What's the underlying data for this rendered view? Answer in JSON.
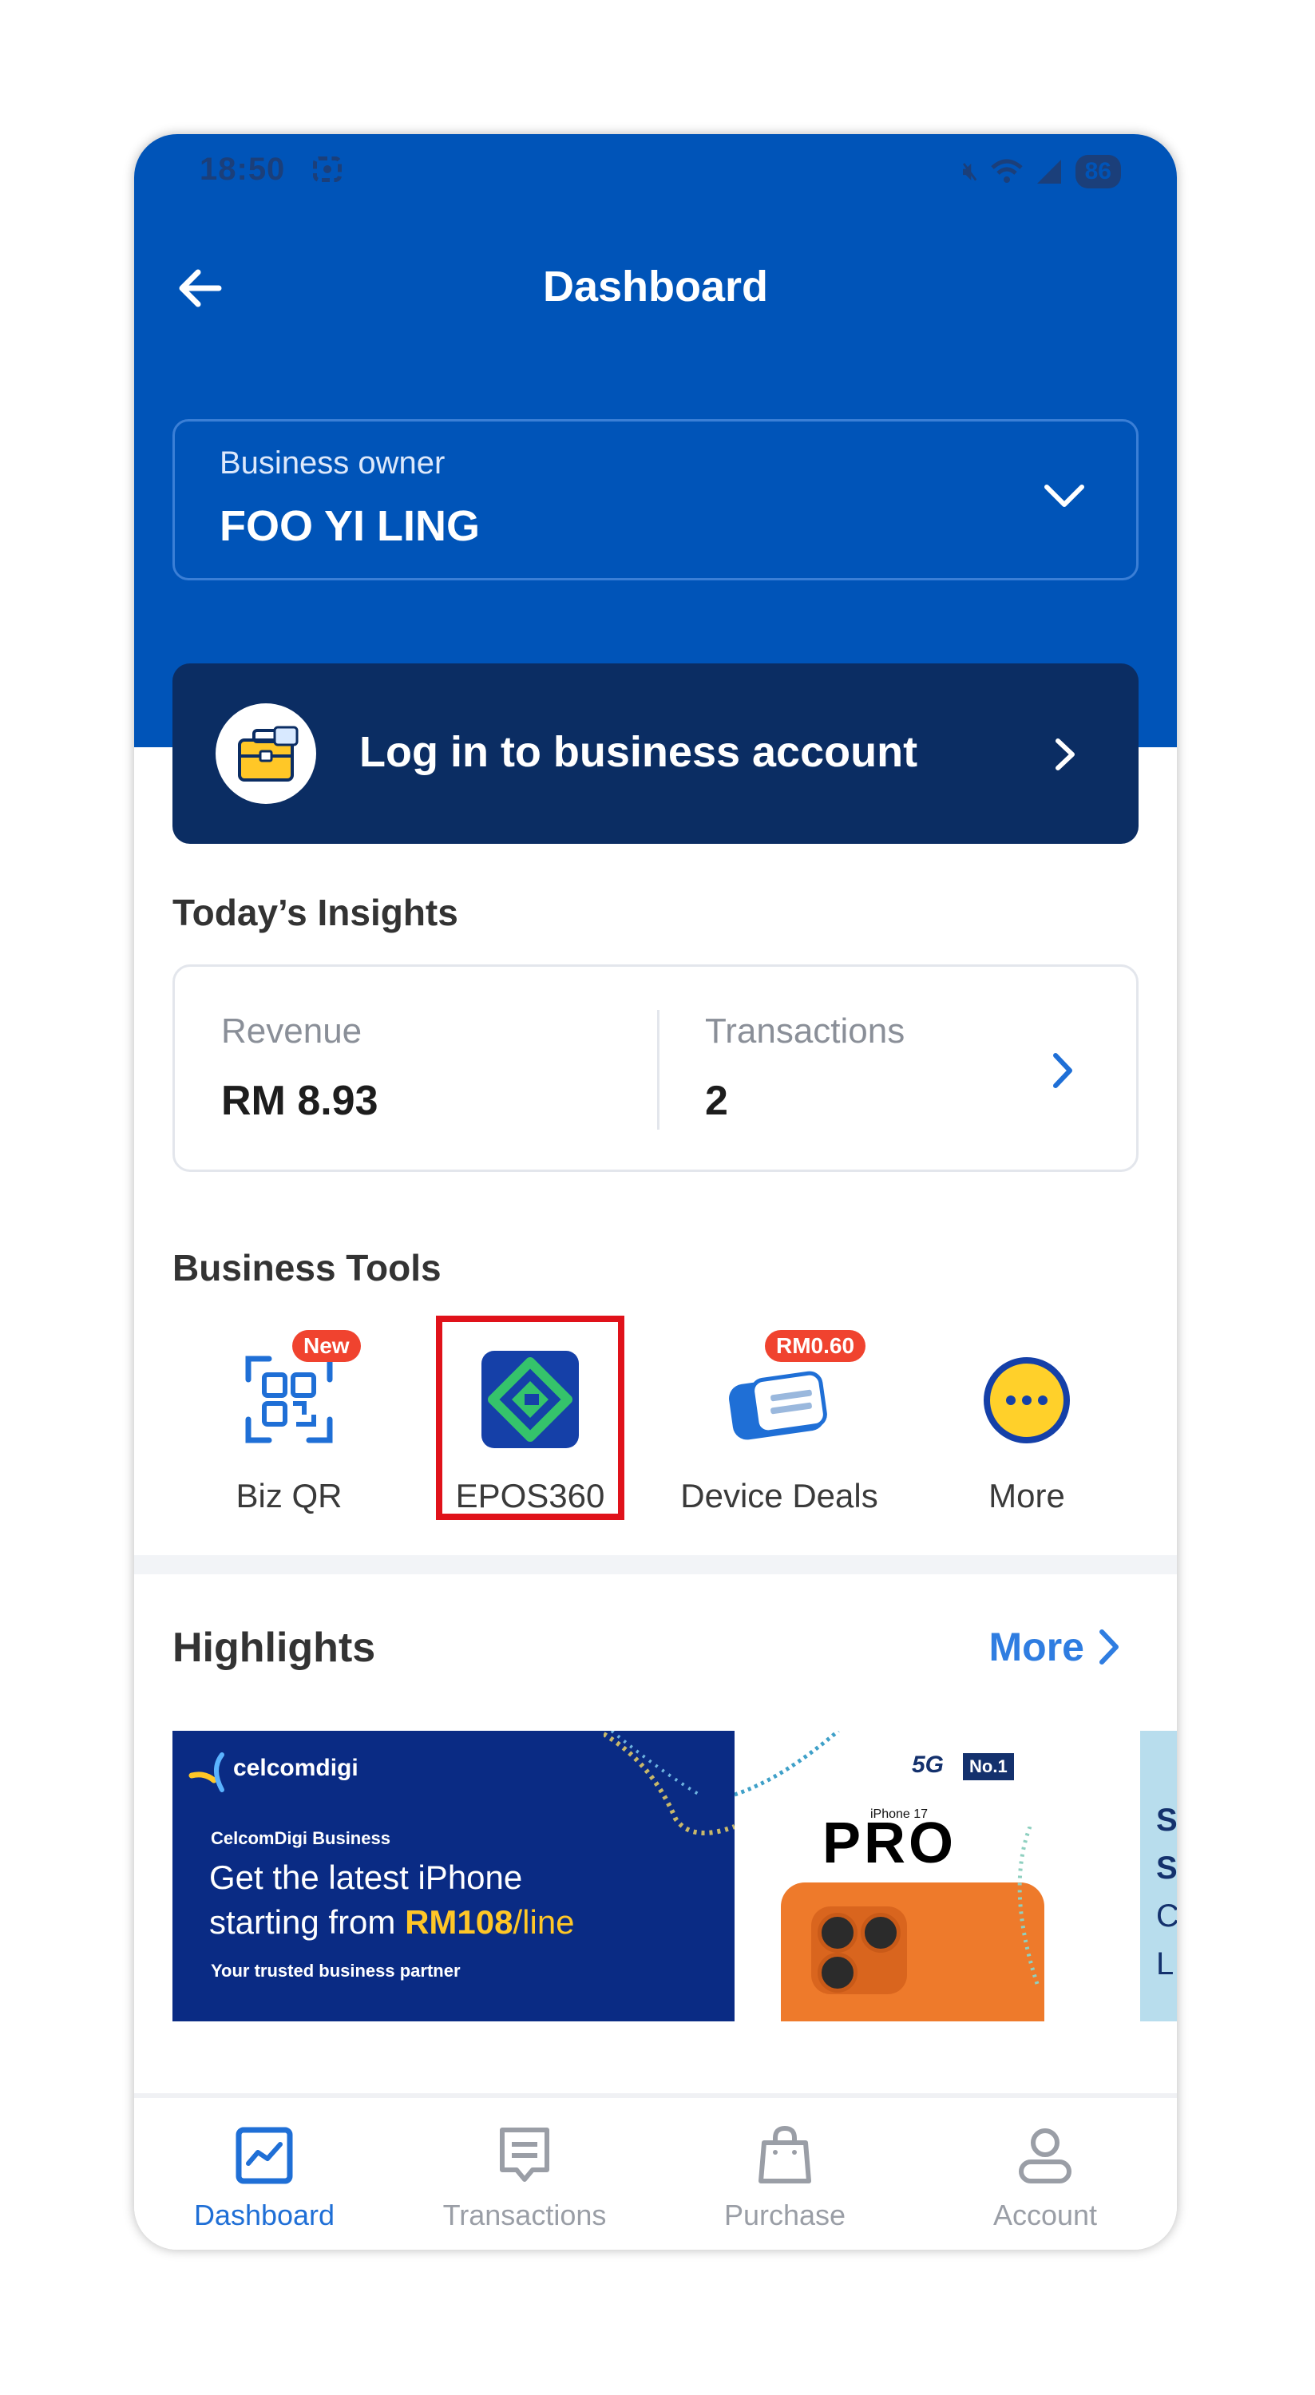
{
  "status_bar": {
    "time": "18:50",
    "battery": "86"
  },
  "header": {
    "title": "Dashboard"
  },
  "owner_selector": {
    "label": "Business owner",
    "name": "FOO YI LING"
  },
  "login_card": {
    "label": "Log in to business account"
  },
  "insights": {
    "title": "Today’s Insights",
    "revenue_label": "Revenue",
    "revenue_value": "RM 8.93",
    "transactions_label": "Transactions",
    "transactions_value": "2"
  },
  "business_tools": {
    "title": "Business Tools",
    "items": [
      {
        "label": "Biz QR",
        "badge": "New",
        "icon": "qr-code-icon"
      },
      {
        "label": "EPOS360",
        "badge": "",
        "icon": "epos360-logo-icon"
      },
      {
        "label": "Device Deals",
        "badge": "RM0.60",
        "icon": "device-icon"
      },
      {
        "label": "More",
        "badge": "",
        "icon": "more-dots-icon"
      }
    ]
  },
  "highlights": {
    "title": "Highlights",
    "more_label": "More",
    "banner": {
      "brand": "celcomdigi",
      "subtitle": "CelcomDigi Business",
      "line1": "Get the latest iPhone",
      "line2_prefix": "starting from ",
      "line2_price": "RM108",
      "line2_suffix": "/line",
      "tagline": "Your trusted business partner",
      "model_small": "iPhone 17",
      "model_big": "PRO",
      "badge_5g": "5G",
      "badge_no1": "No.1"
    },
    "next_banner_peek": [
      "S",
      "S",
      "C",
      "L"
    ]
  },
  "bottom_nav": {
    "items": [
      {
        "label": "Dashboard",
        "icon": "dashboard-chart-icon",
        "active": true
      },
      {
        "label": "Transactions",
        "icon": "receipt-icon",
        "active": false
      },
      {
        "label": "Purchase",
        "icon": "shopping-bag-icon",
        "active": false
      },
      {
        "label": "Account",
        "icon": "person-icon",
        "active": false
      }
    ]
  },
  "colors": {
    "primary_blue": "#0054b8",
    "navy_card": "#0b2d63",
    "accent_link": "#2f7de1",
    "badge_red": "#f0432f",
    "highlight_red": "#e0121a",
    "epos_green": "#35c36b"
  }
}
